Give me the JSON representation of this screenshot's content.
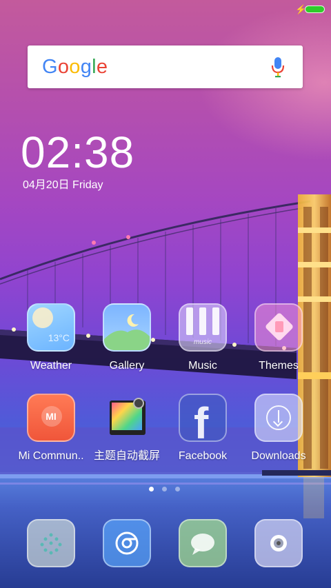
{
  "status_bar": {
    "charging_icon": "bolt-icon",
    "battery_icon": "battery-icon",
    "battery_color": "#2ecc2a"
  },
  "search": {
    "logo_letters": [
      "G",
      "o",
      "o",
      "g",
      "l",
      "e"
    ],
    "logo_colors": [
      "#4285f4",
      "#ea4335",
      "#fbbc05",
      "#4285f4",
      "#34a853",
      "#ea4335"
    ],
    "mic_icon": "mic-icon"
  },
  "clock": {
    "time": "02:38",
    "date": "04月20日 Friday"
  },
  "apps_row1": [
    {
      "label": "Weather",
      "icon": "weather-icon"
    },
    {
      "label": "Gallery",
      "icon": "gallery-icon"
    },
    {
      "label": "Music",
      "icon": "music-icon"
    },
    {
      "label": "Themes",
      "icon": "themes-icon"
    }
  ],
  "weather_icon_text": "13°C",
  "music_icon_text": "music",
  "apps_row2": [
    {
      "label": "Mi Commun..",
      "icon": "mi-community-icon"
    },
    {
      "label": "主题自动截屏",
      "icon": "screenshot-icon"
    },
    {
      "label": "Facebook",
      "icon": "facebook-icon"
    },
    {
      "label": "Downloads",
      "icon": "downloads-icon"
    }
  ],
  "mi_icon_text": "MI",
  "facebook_icon_text": "f",
  "page_indicator": {
    "count": 3,
    "active": 0
  },
  "dock": [
    {
      "icon": "phone-icon"
    },
    {
      "icon": "chrome-icon"
    },
    {
      "icon": "messages-icon"
    },
    {
      "icon": "camera-icon"
    }
  ]
}
